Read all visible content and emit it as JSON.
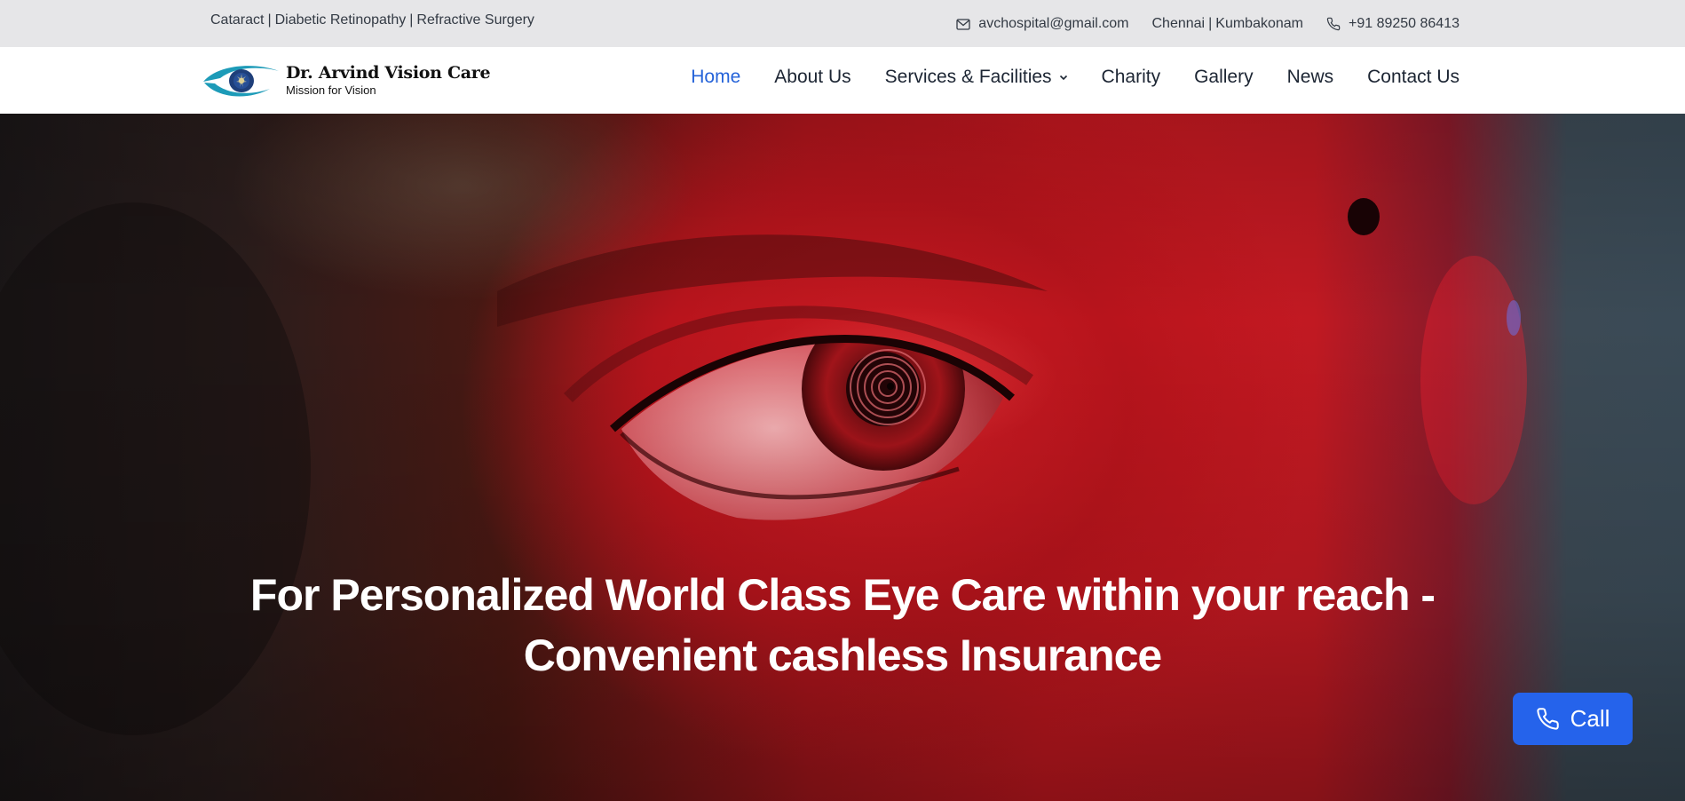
{
  "topbar": {
    "specialties": [
      "Cataract",
      "Diabetic Retinopathy",
      "Refractive Surgery"
    ],
    "email": "avchospital@gmail.com",
    "locations": [
      "Chennai",
      "Kumbakonam"
    ],
    "phone": "+91 89250 86413",
    "separator": "|"
  },
  "header": {
    "logo": {
      "title": "Dr. Arvind Vision Care",
      "tagline": "Mission for Vision"
    },
    "nav": [
      {
        "label": "Home",
        "active": true
      },
      {
        "label": "About Us"
      },
      {
        "label": "Services & Facilities",
        "dropdown": true
      },
      {
        "label": "Charity"
      },
      {
        "label": "Gallery"
      },
      {
        "label": "News"
      },
      {
        "label": "Contact Us"
      }
    ]
  },
  "hero": {
    "heading_line1": "For Personalized World Class Eye Care within your reach -",
    "heading_line2": "Convenient cashless Insurance"
  },
  "call_button": {
    "label": "Call",
    "icon": "phone-icon"
  },
  "colors": {
    "accent": "#2563eb",
    "nav_active": "#2563d9",
    "topbar_bg": "#e6e6e8",
    "logo_teal": "#1d9bb8"
  }
}
